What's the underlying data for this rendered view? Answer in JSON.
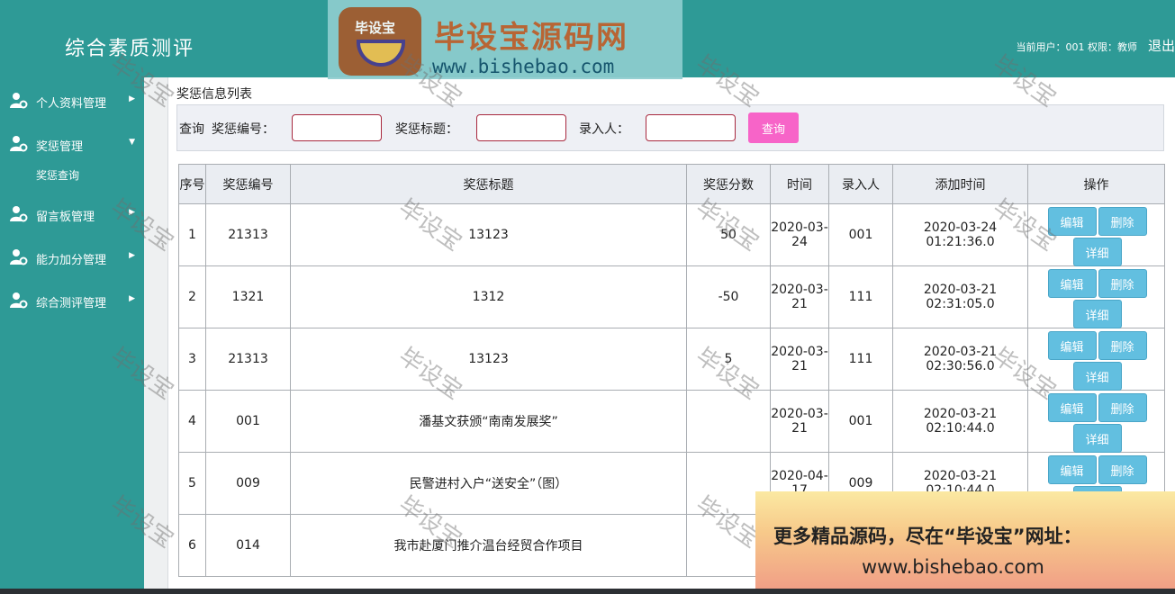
{
  "header": {
    "system_title": "综合素质测评",
    "user_info": "当前用户：001 权限：教师",
    "logout": "退出"
  },
  "logo_watermark": {
    "badge_text": "毕设宝",
    "brand": "毕设宝源码网",
    "url": "www.bishebao.com"
  },
  "sidebar": {
    "items": [
      {
        "label": "个人资料管理",
        "arrow": "▶"
      },
      {
        "label": "奖惩管理",
        "arrow": "▼"
      },
      {
        "label": "留言板管理",
        "arrow": "▶"
      },
      {
        "label": "能力加分管理",
        "arrow": "▶"
      },
      {
        "label": "综合测评管理",
        "arrow": "▶"
      }
    ],
    "submenu": {
      "label": "奖惩查询"
    }
  },
  "main": {
    "list_title": "奖惩信息列表",
    "search": {
      "query_label": "查询",
      "code_label": "奖惩编号：",
      "title_label": "奖惩标题：",
      "recorder_label": "录入人：",
      "button_label": "查询"
    },
    "table": {
      "headers": [
        "序号",
        "奖惩编号",
        "奖惩标题",
        "奖惩分数",
        "时间",
        "录入人",
        "添加时间",
        "操作"
      ],
      "rows": [
        {
          "no": "1",
          "code": "21313",
          "title": "13123",
          "score": "50",
          "date": "2020-03-24",
          "recorder": "001",
          "added": "2020-03-24 01:21:36.0"
        },
        {
          "no": "2",
          "code": "1321",
          "title": "1312",
          "score": "-50",
          "date": "2020-03-21",
          "recorder": "111",
          "added": "2020-03-21 02:31:05.0"
        },
        {
          "no": "3",
          "code": "21313",
          "title": "13123",
          "score": "5",
          "date": "2020-03-21",
          "recorder": "111",
          "added": "2020-03-21 02:30:56.0"
        },
        {
          "no": "4",
          "code": "001",
          "title": "潘基文获颁“南南发展奖”",
          "score": "",
          "date": "2020-03-21",
          "recorder": "001",
          "added": "2020-03-21 02:10:44.0"
        },
        {
          "no": "5",
          "code": "009",
          "title": "民警进村入户“送安全”（图）",
          "score": "",
          "date": "2020-04-17",
          "recorder": "009",
          "added": "2020-03-21 02:10:44.0"
        },
        {
          "no": "6",
          "code": "014",
          "title": "我市赴厦门推介温台经贸合作项目",
          "score": "",
          "date": "",
          "recorder": "",
          "added": ""
        }
      ],
      "ops": {
        "edit": "编辑",
        "delete": "删除",
        "detail": "详细"
      }
    }
  },
  "watermark_text": "毕设宝",
  "promo": {
    "line1": "更多精品源码，尽在“毕设宝”网址：",
    "line2": "www.bishebao.com"
  },
  "colors": {
    "teal": "#2e9a96",
    "pink_button": "#f764c8",
    "op_button": "#62bfe0"
  }
}
